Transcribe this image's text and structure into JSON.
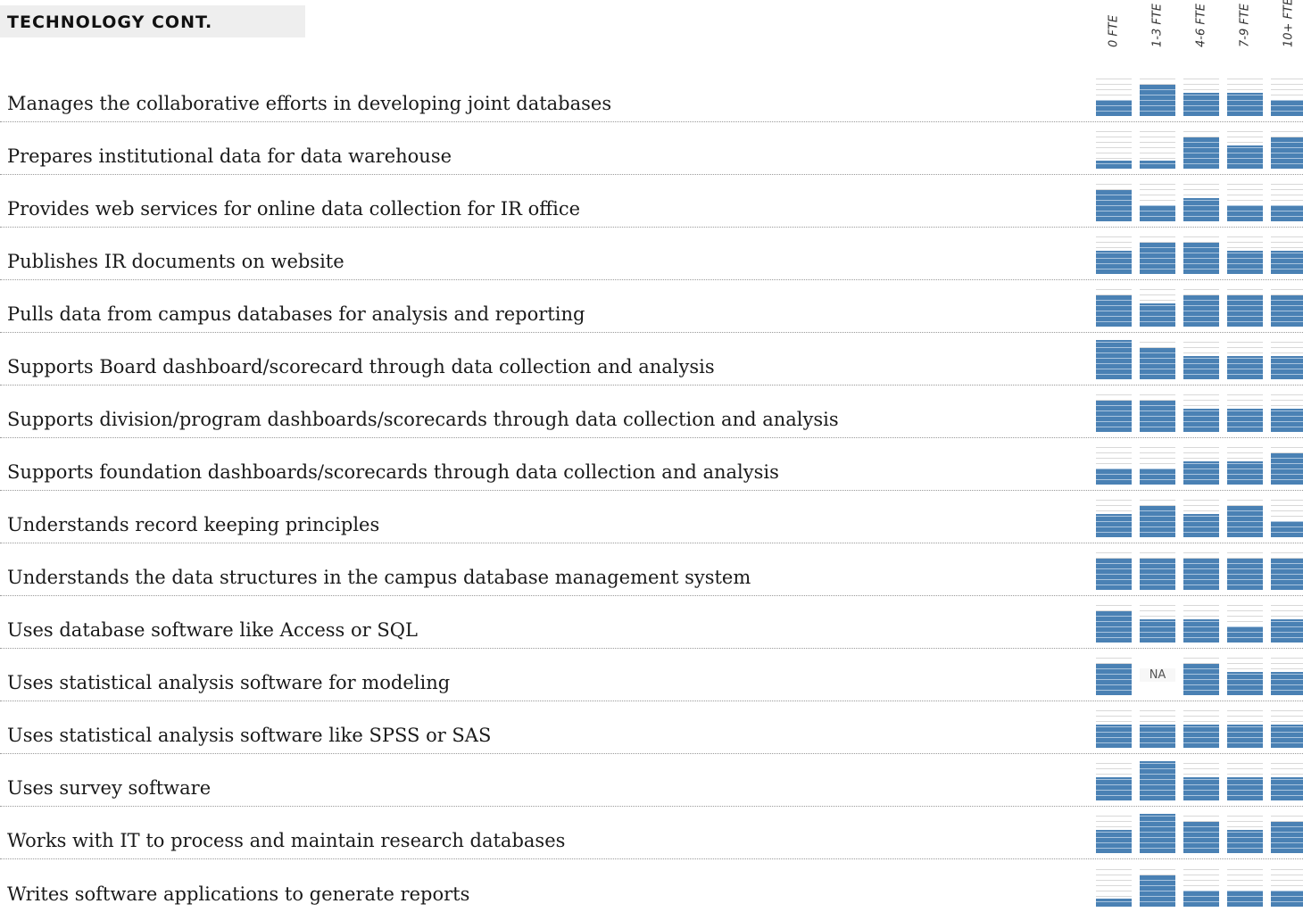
{
  "section_title": "TECHNOLOGY CONT.",
  "colors": {
    "bar_fill": "#4a81b4",
    "bar_line": "#a9c4de",
    "empty_line": "#d8d8d8",
    "header_bg": "#eeeeee"
  },
  "chart_data": {
    "type": "heatmap",
    "title": "TECHNOLOGY CONT.",
    "scale": "each cell shows a level 1-5 as stacked bar height",
    "columns": [
      "0 FTE",
      "1-3 FTE",
      "4-6 FTE",
      "7-9 FTE",
      "10+ FTE"
    ],
    "na_label": "NA",
    "rows": [
      {
        "label": "Manages the collaborative efforts in developing joint databases",
        "values": [
          2,
          4,
          3,
          3,
          2
        ]
      },
      {
        "label": "Prepares institutional data for data warehouse",
        "values": [
          1,
          1,
          4,
          3,
          4
        ]
      },
      {
        "label": "Provides web services for online data collection for IR office",
        "values": [
          4,
          2,
          3,
          2,
          2
        ]
      },
      {
        "label": "Publishes IR documents on website",
        "values": [
          3,
          4,
          4,
          3,
          3
        ]
      },
      {
        "label": "Pulls data from campus databases for analysis and reporting",
        "values": [
          4,
          3,
          4,
          4,
          4
        ]
      },
      {
        "label": "Supports Board dashboard/scorecard through data collection and analysis",
        "values": [
          5,
          4,
          3,
          3,
          3
        ]
      },
      {
        "label": "Supports division/program dashboards/scorecards through data collection and analysis",
        "values": [
          4,
          4,
          3,
          3,
          3
        ]
      },
      {
        "label": "Supports foundation dashboards/scorecards through data collection and analysis",
        "values": [
          2,
          2,
          3,
          3,
          4
        ]
      },
      {
        "label": "Understands record keeping principles",
        "values": [
          3,
          4,
          3,
          4,
          2
        ]
      },
      {
        "label": "Understands the data structures in the campus database management system",
        "values": [
          4,
          4,
          4,
          4,
          4
        ]
      },
      {
        "label": "Uses database software like Access or SQL",
        "values": [
          4,
          3,
          3,
          2,
          3
        ]
      },
      {
        "label": "Uses statistical analysis software for modeling",
        "values": [
          4,
          null,
          4,
          3,
          3
        ]
      },
      {
        "label": "Uses statistical analysis software like SPSS or SAS",
        "values": [
          3,
          3,
          3,
          3,
          3
        ]
      },
      {
        "label": "Uses survey software",
        "values": [
          3,
          5,
          3,
          3,
          3
        ]
      },
      {
        "label": "Works with IT to process and maintain research databases",
        "values": [
          3,
          5,
          4,
          3,
          4
        ]
      },
      {
        "label": "Writes software applications to generate reports",
        "values": [
          1,
          4,
          2,
          2,
          2
        ]
      }
    ]
  }
}
